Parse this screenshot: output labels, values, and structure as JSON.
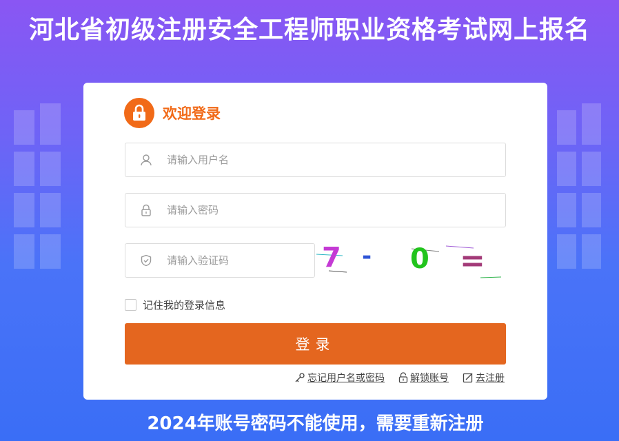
{
  "page": {
    "title": "河北省初级注册安全工程师职业资格考试网上报名",
    "notice": "2024年账号密码不能使用，需要重新注册"
  },
  "login": {
    "header": "欢迎登录",
    "username_placeholder": "请输入用户名",
    "password_placeholder": "请输入密码",
    "captcha_placeholder": "请输入验证码",
    "captcha_text": [
      "7",
      "-",
      "0",
      "="
    ],
    "remember_label": "记住我的登录信息",
    "submit_label": "登录",
    "links": {
      "forgot": "忘记用户名或密码",
      "unlock": "解锁账号",
      "register": "去注册"
    }
  },
  "colors": {
    "accent": "#e4661f",
    "header_orange": "#f16a18",
    "bg_top": "#8a56f3",
    "bg_bottom": "#3a6ef6"
  },
  "icons": {
    "header": "lock-icon",
    "username": "user-icon",
    "password": "lock-icon",
    "captcha": "shield-icon",
    "forgot": "key-icon",
    "unlock": "unlock-icon",
    "register": "edit-icon"
  }
}
